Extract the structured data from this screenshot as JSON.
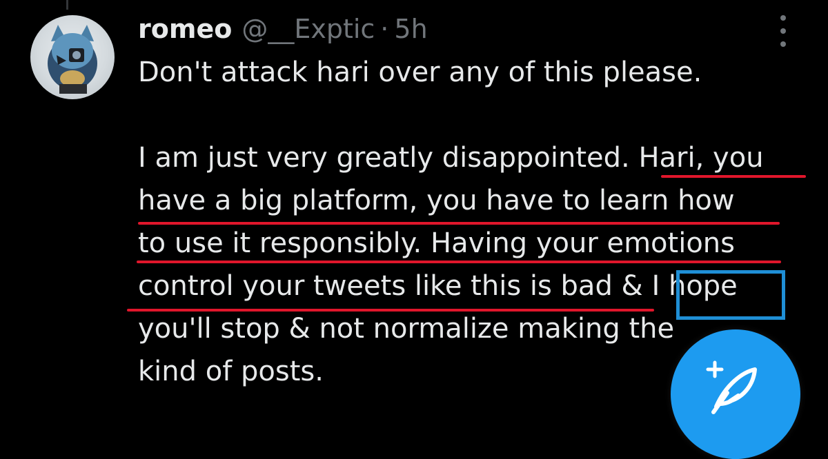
{
  "tweet": {
    "author": {
      "display_name": "romeo",
      "handle": "@__Exptic",
      "avatar_icon": "avatar-cartoon-icon"
    },
    "separator": "·",
    "timestamp": "5h",
    "lines": [
      "Don't attack hari over any of this please.",
      "",
      "I am just very greatly disappointed. Hari, you",
      "have a big platform, you have to learn how",
      "to use it responsibly. Having your emotions",
      "control your tweets like this is bad & I hope",
      "you'll stop & not normalize making the",
      "kind of posts."
    ],
    "more_icon": "more-vertical-icon"
  },
  "annotations": {
    "underline_color": "#e0162b",
    "box_color": "#1f8fd6"
  },
  "compose": {
    "icon": "compose-feather-plus-icon",
    "color": "#1d9bf0"
  }
}
